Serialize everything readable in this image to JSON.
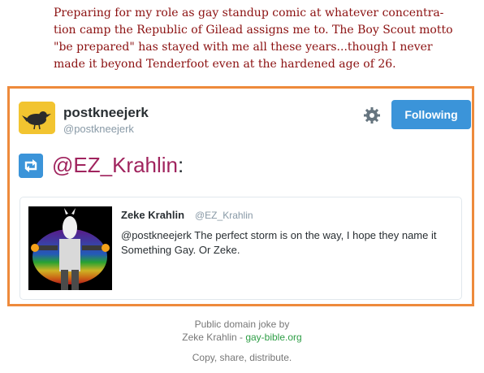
{
  "caption": "Preparing for my role as gay standup comic at whatever concentra-\ntion camp the Republic of Gilead assigns me to. The Boy Scout motto\n\"be prepared\" has stayed with me all these years...though I never\nmade it beyond Tenderfoot even at the hardened age of 26.",
  "tweet": {
    "username": "postkneejerk",
    "handle": "@postkneejerk",
    "follow_label": "Following",
    "retweet_mention": "@EZ_Krahlin",
    "retweet_suffix": ":",
    "quoted": {
      "name": "Zeke Krahlin",
      "handle": "@EZ_Krahlin",
      "text": "@postkneejerk The perfect storm is on the way, I hope they name it Something Gay. Or Zeke."
    }
  },
  "footer": {
    "line1": "Public domain joke by",
    "line2_prefix": "Zeke Krahlin - ",
    "line2_link": "gay-bible.org",
    "line3": "Copy, share, distribute."
  },
  "colors": {
    "caption": "#8b1010",
    "card_border": "#ee8a3b",
    "follow_button": "#3b94d9",
    "mention": "#a0245e",
    "footer_link": "#2e9e46"
  },
  "icons": {
    "avatar": "bird-avatar-icon",
    "settings": "gear-icon",
    "retweet": "retweet-icon"
  }
}
